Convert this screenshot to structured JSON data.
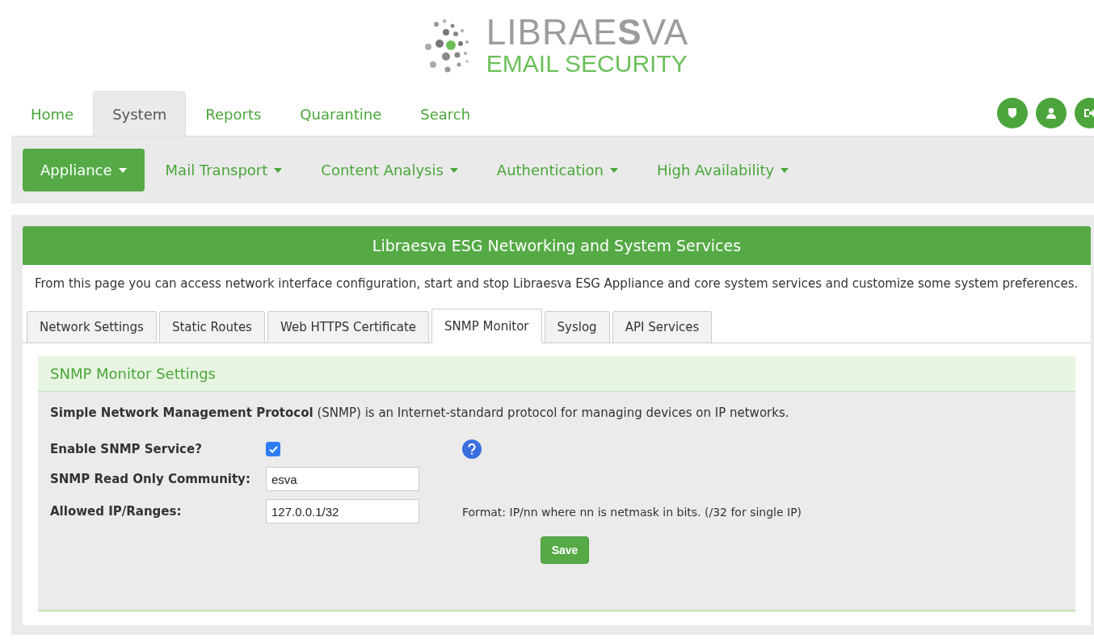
{
  "logo": {
    "brand": "LIBRAE**S**VA",
    "tagline": "EMAIL SECURITY"
  },
  "main_tabs": [
    {
      "label": "Home",
      "selected": false
    },
    {
      "label": "System",
      "selected": true
    },
    {
      "label": "Reports",
      "selected": false
    },
    {
      "label": "Quarantine",
      "selected": false
    },
    {
      "label": "Search",
      "selected": false
    }
  ],
  "header_icons": [
    {
      "kind": "shield"
    },
    {
      "kind": "user"
    },
    {
      "kind": "logout"
    }
  ],
  "sub_menu": [
    {
      "label": "Appliance",
      "selected": true
    },
    {
      "label": "Mail Transport",
      "selected": false
    },
    {
      "label": "Content Analysis",
      "selected": false
    },
    {
      "label": "Authentication",
      "selected": false
    },
    {
      "label": "High Availability",
      "selected": false
    }
  ],
  "panel": {
    "title": "Libraesva ESG Networking and System Services",
    "description": "From this page you can access network interface configuration, start and stop Libraesva ESG Appliance and core system services and customize some system preferences."
  },
  "tabs": [
    {
      "label": "Network Settings",
      "selected": false
    },
    {
      "label": "Static Routes",
      "selected": false
    },
    {
      "label": "Web HTTPS Certificate",
      "selected": false
    },
    {
      "label": "SNMP Monitor",
      "selected": true
    },
    {
      "label": "Syslog",
      "selected": false
    },
    {
      "label": "API Services",
      "selected": false
    }
  ],
  "section": {
    "title": "SNMP Monitor Settings",
    "intro": "**Simple Network Management Protocol** (SNMP) is an Internet-standard protocol for managing devices on IP networks."
  },
  "fields": [
    {
      "kind": "checkbox",
      "label": "Enable SNMP Service?",
      "checked": true,
      "help": true
    },
    {
      "kind": "text",
      "label": "SNMP Read Only Community:",
      "value": "esva"
    },
    {
      "kind": "text",
      "label": "Allowed IP/Ranges:",
      "value": "127.0.0.1/32",
      "hint": "Format: IP/nn where nn is netmask in bits. (/32 for single IP)"
    }
  ],
  "save_button": "Save"
}
